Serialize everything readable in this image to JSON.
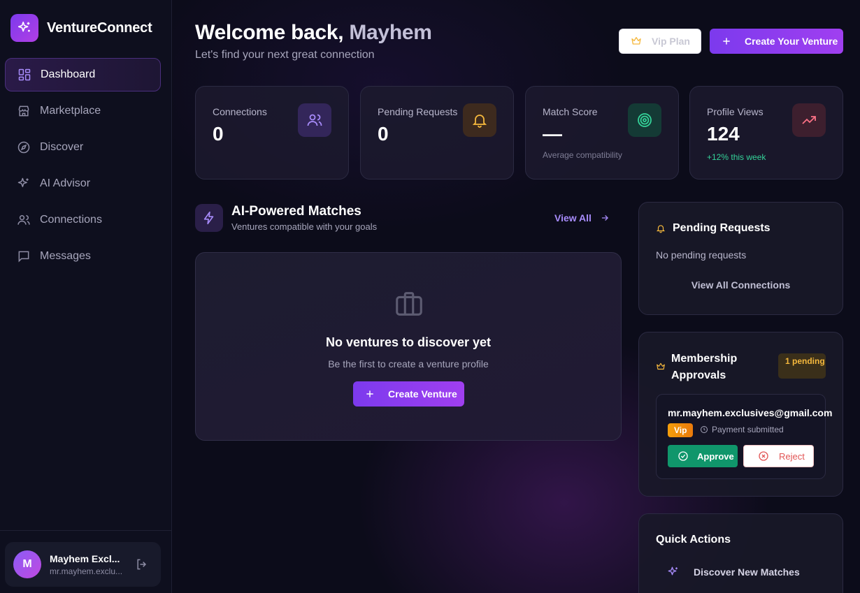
{
  "app": {
    "name": "VentureConnect"
  },
  "nav": {
    "items": [
      {
        "label": "Dashboard",
        "icon": "dashboard-icon",
        "active": true
      },
      {
        "label": "Marketplace",
        "icon": "store-icon"
      },
      {
        "label": "Discover",
        "icon": "compass-icon"
      },
      {
        "label": "AI Advisor",
        "icon": "sparkles-icon"
      },
      {
        "label": "Connections",
        "icon": "users-icon"
      },
      {
        "label": "Messages",
        "icon": "message-icon"
      }
    ]
  },
  "user": {
    "initial": "M",
    "name": "Mayhem Excl...",
    "email": "mr.mayhem.exclu..."
  },
  "header": {
    "welcome_prefix": "Welcome back,",
    "user_name": "Mayhem",
    "subtitle": "Let's find your next great connection",
    "vip_label": "Vip Plan",
    "create_label": "Create Your Venture"
  },
  "stats": [
    {
      "label": "Connections",
      "value": "0",
      "icon": "users-icon",
      "accent": "#a78bfa"
    },
    {
      "label": "Pending Requests",
      "value": "0",
      "icon": "bell-icon",
      "accent": "#f5b83d"
    },
    {
      "label": "Match Score",
      "value": "—",
      "sub": "Average compatibility",
      "icon": "target-icon",
      "accent": "#34d399"
    },
    {
      "label": "Profile Views",
      "value": "124",
      "sub": "+12% this week",
      "icon": "trending-up-icon",
      "accent": "#fb7185"
    }
  ],
  "matches": {
    "title": "AI-Powered Matches",
    "subtitle": "Ventures compatible with your goals",
    "view_all": "View All",
    "empty_title": "No ventures to discover yet",
    "empty_sub": "Be the first to create a venture profile",
    "create_label": "Create Venture"
  },
  "pending": {
    "title": "Pending Requests",
    "empty": "No pending requests",
    "link": "View All Connections"
  },
  "membership": {
    "title": "Membership Approvals",
    "badge": "1 pending",
    "item": {
      "email": "mr.mayhem.exclusives@gmail.com",
      "tier": "Vip",
      "status": "Payment submitted",
      "approve": "Approve",
      "reject": "Reject"
    }
  },
  "quick_actions": {
    "title": "Quick Actions",
    "items": [
      {
        "label": "Discover New Matches",
        "icon": "sparkles-icon"
      }
    ]
  },
  "colors": {
    "accent": "#7c3aed",
    "success": "#10966b",
    "danger": "#e25555",
    "warning": "#f5b83d"
  }
}
